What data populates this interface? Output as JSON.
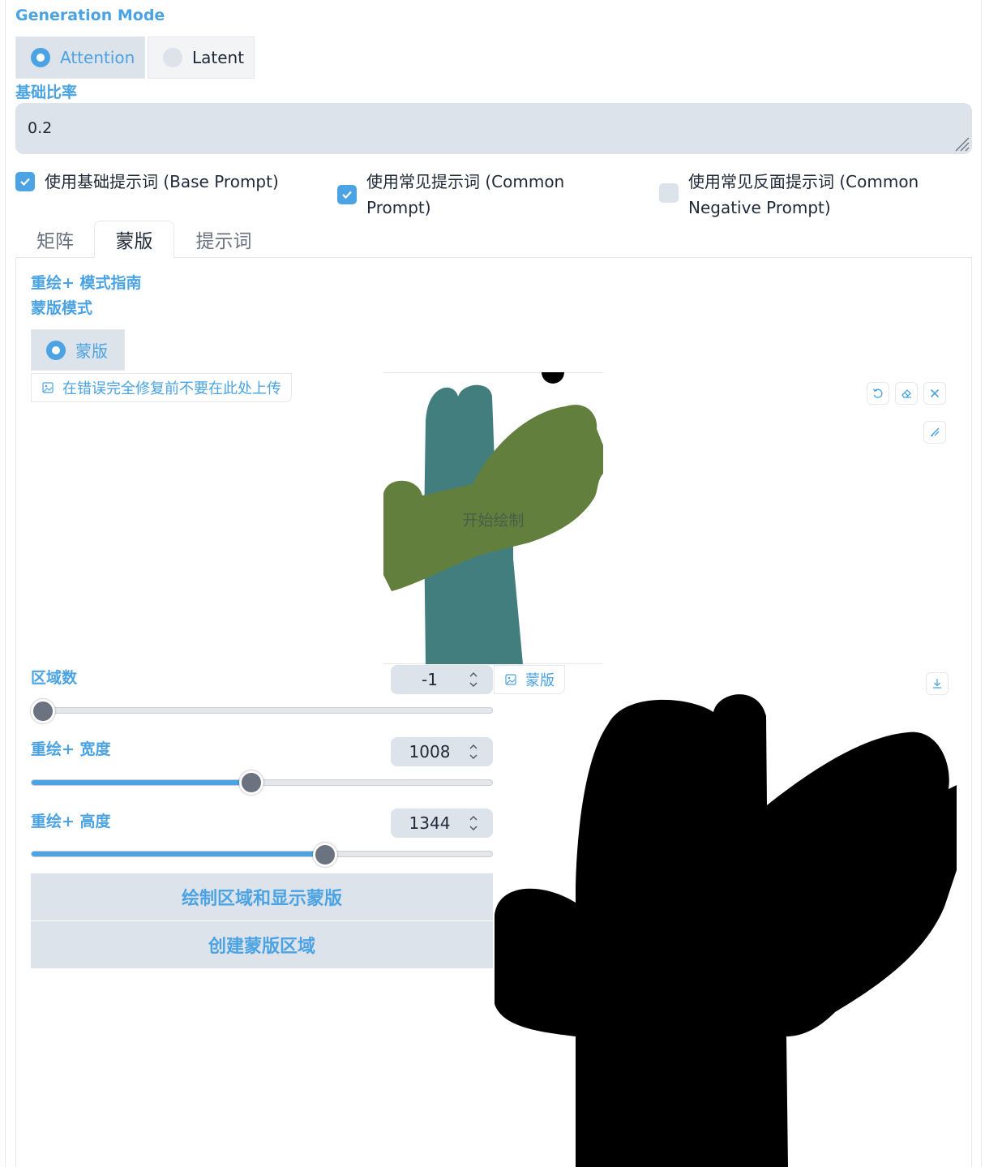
{
  "generation_mode": {
    "label": "Generation Mode",
    "options": [
      "Attention",
      "Latent"
    ],
    "selected": "Attention"
  },
  "base_ratio": {
    "label": "基础比率",
    "value": "0.2"
  },
  "checkboxes": [
    {
      "line1": "使用基础提示词 (Base Prompt)",
      "line2": "",
      "checked": true
    },
    {
      "line1": "使用常见提示词 (Common",
      "line2": "Prompt)",
      "checked": true
    },
    {
      "line1": "使用常见反面提示词 (Common",
      "line2": "Negative Prompt)",
      "checked": false
    }
  ],
  "tabs": [
    "矩阵",
    "蒙版",
    "提示词"
  ],
  "active_tab": "蒙版",
  "mask_panel": {
    "guide_title": "重绘+ 模式指南",
    "mask_mode_label": "蒙版模式",
    "mask_option": "蒙版",
    "upload_warning": "在错误完全修复前不要在此处上传",
    "canvas_hint": "开始绘制",
    "mask_output_label": "蒙版"
  },
  "region_count": {
    "label": "区域数",
    "value": "-1",
    "min": -1,
    "max": 20
  },
  "width": {
    "label": "重绘+ 宽度",
    "value": "1008",
    "min": 64,
    "max": 2048
  },
  "height": {
    "label": "重绘+ 高度",
    "value": "1344",
    "min": 64,
    "max": 2048
  },
  "buttons": {
    "draw_region": "绘制区域和显示蒙版",
    "create_mask": "创建蒙版区域"
  },
  "colors": {
    "accent": "#4ba3e3",
    "brush_teal": "#437e7e",
    "brush_green": "#627f3d",
    "panel_bg": "#dde3ea",
    "mask_black": "#000000"
  },
  "icons": {
    "canvas_tools": [
      "undo-icon",
      "eraser-icon",
      "clear-icon",
      "brush-icon"
    ],
    "download": "download-icon",
    "image": "image-icon"
  }
}
